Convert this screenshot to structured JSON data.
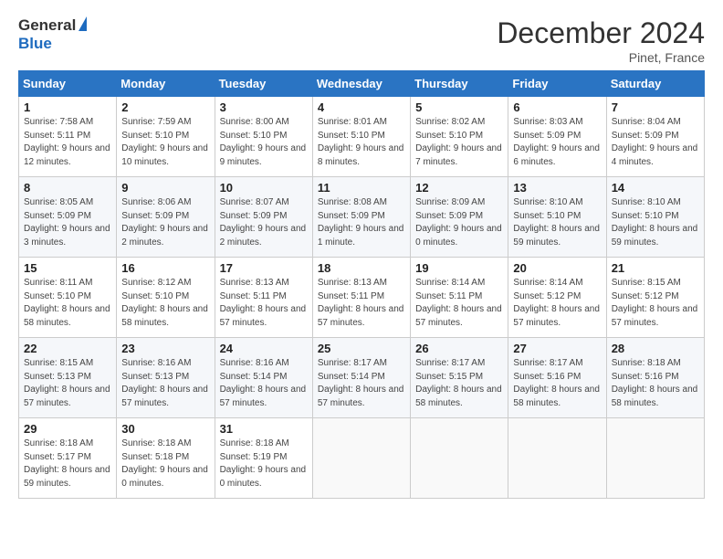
{
  "header": {
    "logo_general": "General",
    "logo_blue": "Blue",
    "title": "December 2024",
    "subtitle": "Pinet, France"
  },
  "weekdays": [
    "Sunday",
    "Monday",
    "Tuesday",
    "Wednesday",
    "Thursday",
    "Friday",
    "Saturday"
  ],
  "weeks": [
    [
      {
        "day": "1",
        "sunrise": "7:58 AM",
        "sunset": "5:11 PM",
        "daylight": "9 hours and 12 minutes."
      },
      {
        "day": "2",
        "sunrise": "7:59 AM",
        "sunset": "5:10 PM",
        "daylight": "9 hours and 10 minutes."
      },
      {
        "day": "3",
        "sunrise": "8:00 AM",
        "sunset": "5:10 PM",
        "daylight": "9 hours and 9 minutes."
      },
      {
        "day": "4",
        "sunrise": "8:01 AM",
        "sunset": "5:10 PM",
        "daylight": "9 hours and 8 minutes."
      },
      {
        "day": "5",
        "sunrise": "8:02 AM",
        "sunset": "5:10 PM",
        "daylight": "9 hours and 7 minutes."
      },
      {
        "day": "6",
        "sunrise": "8:03 AM",
        "sunset": "5:09 PM",
        "daylight": "9 hours and 6 minutes."
      },
      {
        "day": "7",
        "sunrise": "8:04 AM",
        "sunset": "5:09 PM",
        "daylight": "9 hours and 4 minutes."
      }
    ],
    [
      {
        "day": "8",
        "sunrise": "8:05 AM",
        "sunset": "5:09 PM",
        "daylight": "9 hours and 3 minutes."
      },
      {
        "day": "9",
        "sunrise": "8:06 AM",
        "sunset": "5:09 PM",
        "daylight": "9 hours and 2 minutes."
      },
      {
        "day": "10",
        "sunrise": "8:07 AM",
        "sunset": "5:09 PM",
        "daylight": "9 hours and 2 minutes."
      },
      {
        "day": "11",
        "sunrise": "8:08 AM",
        "sunset": "5:09 PM",
        "daylight": "9 hours and 1 minute."
      },
      {
        "day": "12",
        "sunrise": "8:09 AM",
        "sunset": "5:09 PM",
        "daylight": "9 hours and 0 minutes."
      },
      {
        "day": "13",
        "sunrise": "8:10 AM",
        "sunset": "5:10 PM",
        "daylight": "8 hours and 59 minutes."
      },
      {
        "day": "14",
        "sunrise": "8:10 AM",
        "sunset": "5:10 PM",
        "daylight": "8 hours and 59 minutes."
      }
    ],
    [
      {
        "day": "15",
        "sunrise": "8:11 AM",
        "sunset": "5:10 PM",
        "daylight": "8 hours and 58 minutes."
      },
      {
        "day": "16",
        "sunrise": "8:12 AM",
        "sunset": "5:10 PM",
        "daylight": "8 hours and 58 minutes."
      },
      {
        "day": "17",
        "sunrise": "8:13 AM",
        "sunset": "5:11 PM",
        "daylight": "8 hours and 57 minutes."
      },
      {
        "day": "18",
        "sunrise": "8:13 AM",
        "sunset": "5:11 PM",
        "daylight": "8 hours and 57 minutes."
      },
      {
        "day": "19",
        "sunrise": "8:14 AM",
        "sunset": "5:11 PM",
        "daylight": "8 hours and 57 minutes."
      },
      {
        "day": "20",
        "sunrise": "8:14 AM",
        "sunset": "5:12 PM",
        "daylight": "8 hours and 57 minutes."
      },
      {
        "day": "21",
        "sunrise": "8:15 AM",
        "sunset": "5:12 PM",
        "daylight": "8 hours and 57 minutes."
      }
    ],
    [
      {
        "day": "22",
        "sunrise": "8:15 AM",
        "sunset": "5:13 PM",
        "daylight": "8 hours and 57 minutes."
      },
      {
        "day": "23",
        "sunrise": "8:16 AM",
        "sunset": "5:13 PM",
        "daylight": "8 hours and 57 minutes."
      },
      {
        "day": "24",
        "sunrise": "8:16 AM",
        "sunset": "5:14 PM",
        "daylight": "8 hours and 57 minutes."
      },
      {
        "day": "25",
        "sunrise": "8:17 AM",
        "sunset": "5:14 PM",
        "daylight": "8 hours and 57 minutes."
      },
      {
        "day": "26",
        "sunrise": "8:17 AM",
        "sunset": "5:15 PM",
        "daylight": "8 hours and 58 minutes."
      },
      {
        "day": "27",
        "sunrise": "8:17 AM",
        "sunset": "5:16 PM",
        "daylight": "8 hours and 58 minutes."
      },
      {
        "day": "28",
        "sunrise": "8:18 AM",
        "sunset": "5:16 PM",
        "daylight": "8 hours and 58 minutes."
      }
    ],
    [
      {
        "day": "29",
        "sunrise": "8:18 AM",
        "sunset": "5:17 PM",
        "daylight": "8 hours and 59 minutes."
      },
      {
        "day": "30",
        "sunrise": "8:18 AM",
        "sunset": "5:18 PM",
        "daylight": "9 hours and 0 minutes."
      },
      {
        "day": "31",
        "sunrise": "8:18 AM",
        "sunset": "5:19 PM",
        "daylight": "9 hours and 0 minutes."
      },
      null,
      null,
      null,
      null
    ]
  ],
  "labels": {
    "sunrise": "Sunrise:",
    "sunset": "Sunset:",
    "daylight": "Daylight:"
  }
}
